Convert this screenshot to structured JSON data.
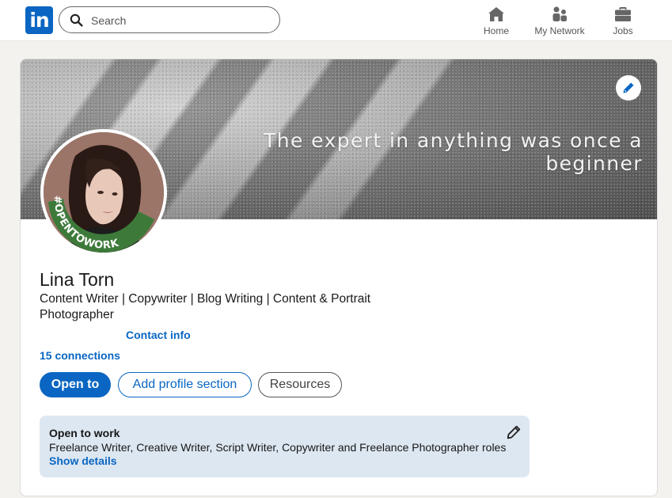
{
  "nav": {
    "logo_text": "in",
    "search_placeholder": "Search",
    "items": [
      {
        "label": "Home",
        "icon": "home-icon"
      },
      {
        "label": "My Network",
        "icon": "network-icon"
      },
      {
        "label": "Jobs",
        "icon": "briefcase-icon"
      }
    ]
  },
  "profile": {
    "banner_quote": "The expert in anything was once a beginner",
    "avatar_badge_text": "#OPENTOWORK",
    "name": "Lina Torn",
    "headline": "Content Writer | Copywriter | Blog Writing | Content & Portrait Photographer",
    "contact_info_label": "Contact info",
    "connections_label": "15 connections",
    "buttons": {
      "open_to": "Open to",
      "add_section": "Add profile section",
      "resources": "Resources"
    },
    "open_to_work": {
      "title": "Open to work",
      "roles": "Freelance Writer, Creative Writer, Script Writer, Copywriter and Freelance Photographer roles",
      "show_details": "Show details"
    }
  },
  "colors": {
    "brand_blue": "#0a66c2",
    "open_to_work_green": "#3d7a3a",
    "open_to_work_bg": "#dde7f1"
  }
}
